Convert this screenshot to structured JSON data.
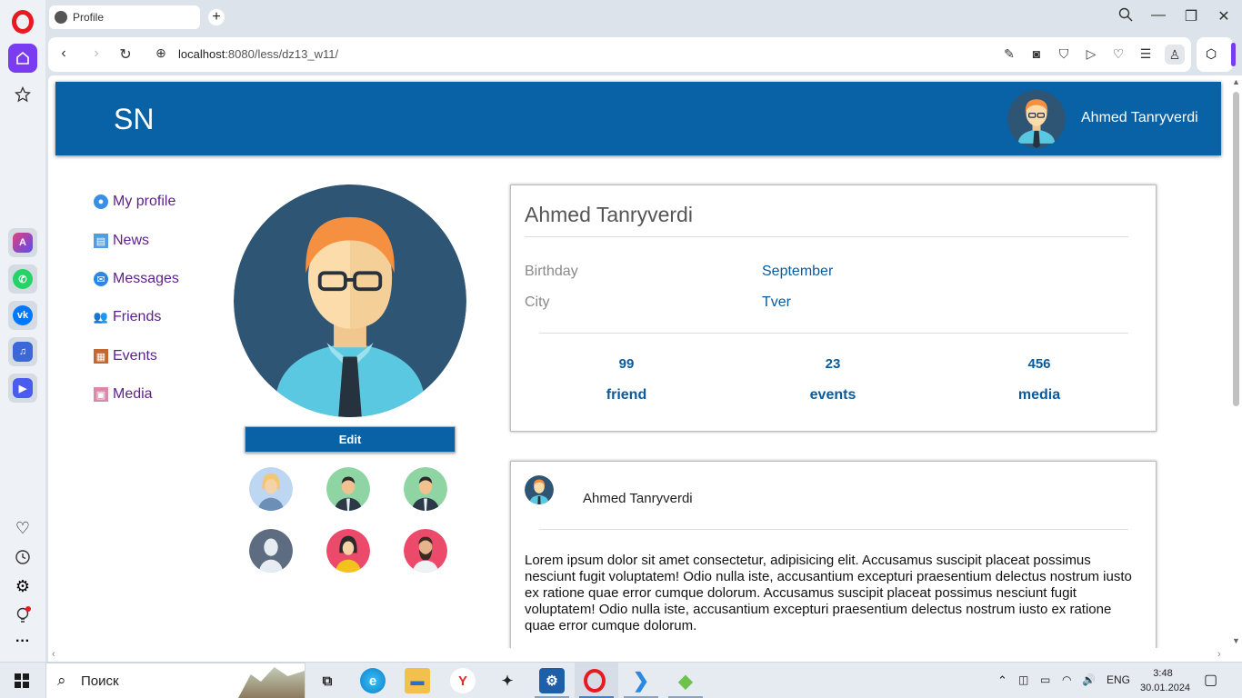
{
  "browser": {
    "tab_title": "Profile",
    "new_tab_label": "+",
    "url_host": "localhost",
    "url_rest": ":8080/less/dz13_w11/"
  },
  "site": {
    "logo": "SN",
    "header_user_name": "Ahmed Tanryverdi"
  },
  "menu": {
    "items": [
      {
        "label": "My profile",
        "icon": "user-circle-icon"
      },
      {
        "label": "News",
        "icon": "newspaper-icon"
      },
      {
        "label": "Messages",
        "icon": "chat-bubble-icon"
      },
      {
        "label": "Friends",
        "icon": "people-icon"
      },
      {
        "label": "Events",
        "icon": "calendar-icon"
      },
      {
        "label": "Media",
        "icon": "picture-icon"
      }
    ]
  },
  "profile": {
    "edit_label": "Edit",
    "name": "Ahmed Tanryverdi",
    "birthday_label": "Birthday",
    "birthday_value": "September",
    "city_label": "City",
    "city_value": "Tver",
    "stats": [
      {
        "value": "99",
        "label": "friend"
      },
      {
        "value": "23",
        "label": "events"
      },
      {
        "value": "456",
        "label": "media"
      }
    ]
  },
  "post": {
    "author": "Ahmed Tanryverdi",
    "text": "Lorem ipsum dolor sit amet consectetur, adipisicing elit. Accusamus suscipit placeat possimus nesciunt fugit voluptatem! Odio nulla iste, accusantium excepturi praesentium delectus nostrum iusto ex ratione quae error cumque dolorum. Accusamus suscipit placeat possimus nesciunt fugit voluptatem! Odio nulla iste, accusantium excepturi praesentium delectus nostrum iusto ex ratione quae error cumque dolorum."
  },
  "taskbar": {
    "search_placeholder": "Поиск",
    "language": "ENG",
    "time": "3:48",
    "date": "30.01.2024"
  },
  "colors": {
    "brand": "#0862a5",
    "menu_text": "#5c1f8b",
    "value_text": "#0a5a9c",
    "opera_accent": "#7a3cf0"
  }
}
